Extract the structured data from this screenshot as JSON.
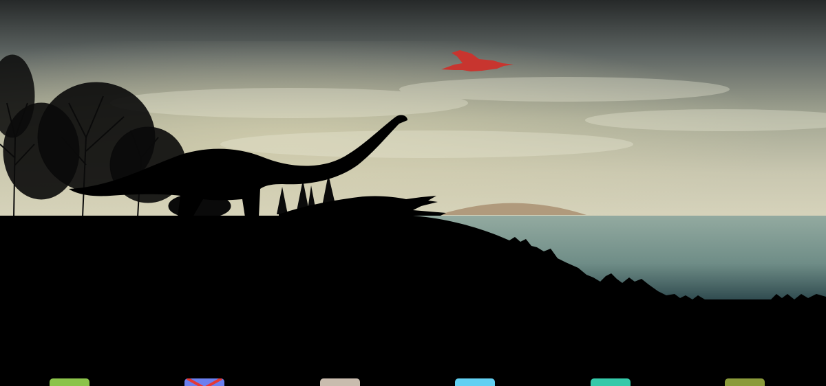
{
  "wallpaper": {
    "name": "prehistoric-dusk-scene",
    "colors": {
      "sky_top": "#2b2e2e",
      "sky_mid": "#8a8f86",
      "haze": "#d2cfae",
      "water": "#8aa49a",
      "water_deep": "#2f4a4f",
      "hill": "#b39a7a",
      "silhouette": "#000000",
      "pterosaur": "#c8352f"
    }
  },
  "dock": {
    "apps": [
      {
        "name": "app-icon-1",
        "icon": "green-app-icon",
        "color": "#8bc34a"
      },
      {
        "name": "app-icon-2",
        "icon": "gmail-icon",
        "color": "#6a7ff0",
        "accent": "#e53935"
      },
      {
        "name": "app-icon-3",
        "icon": "beige-app-icon",
        "color": "#c9bcae"
      },
      {
        "name": "app-icon-4",
        "icon": "lightblue-app-icon",
        "color": "#62d0f2"
      },
      {
        "name": "app-icon-5",
        "icon": "teal-app-icon",
        "color": "#35c9a9"
      },
      {
        "name": "app-icon-6",
        "icon": "olive-app-icon",
        "color": "#8a9a3a"
      }
    ]
  }
}
